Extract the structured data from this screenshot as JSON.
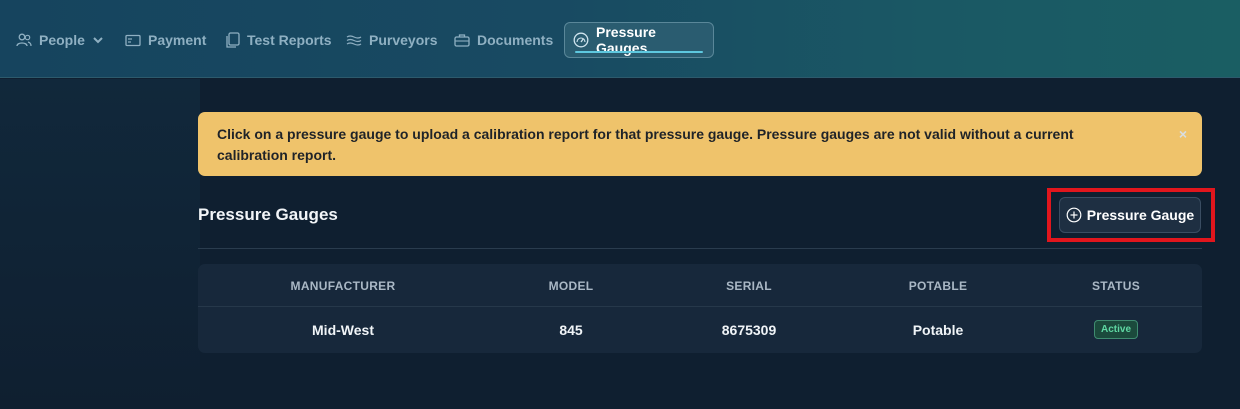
{
  "nav": {
    "items": [
      {
        "label": "People",
        "icon": "people-icon",
        "has_dropdown": true
      },
      {
        "label": "Payment",
        "icon": "payment-icon"
      },
      {
        "label": "Test Reports",
        "icon": "document-copy-icon"
      },
      {
        "label": "Purveyors",
        "icon": "water-lines-icon"
      },
      {
        "label": "Documents",
        "icon": "briefcase-icon"
      },
      {
        "label": "Pressure Gauges",
        "icon": "gauge-icon",
        "active": true
      }
    ]
  },
  "alert": {
    "text": "Click on a pressure gauge to upload a calibration report for that pressure gauge. Pressure gauges are not valid without a current calibration report.",
    "close": "×",
    "color": "#efc36b"
  },
  "section": {
    "title": "Pressure Gauges",
    "add_button_label": "Pressure Gauge"
  },
  "table": {
    "headers": [
      "MANUFACTURER",
      "MODEL",
      "SERIAL",
      "POTABLE",
      "STATUS"
    ],
    "rows": [
      {
        "manufacturer": "Mid-West",
        "model": "845",
        "serial": "8675309",
        "potable": "Potable",
        "status": "Active"
      }
    ]
  },
  "colors": {
    "accent": "#5ec8df",
    "status_active": "#5fd8a3",
    "highlight": "#e1161d"
  }
}
